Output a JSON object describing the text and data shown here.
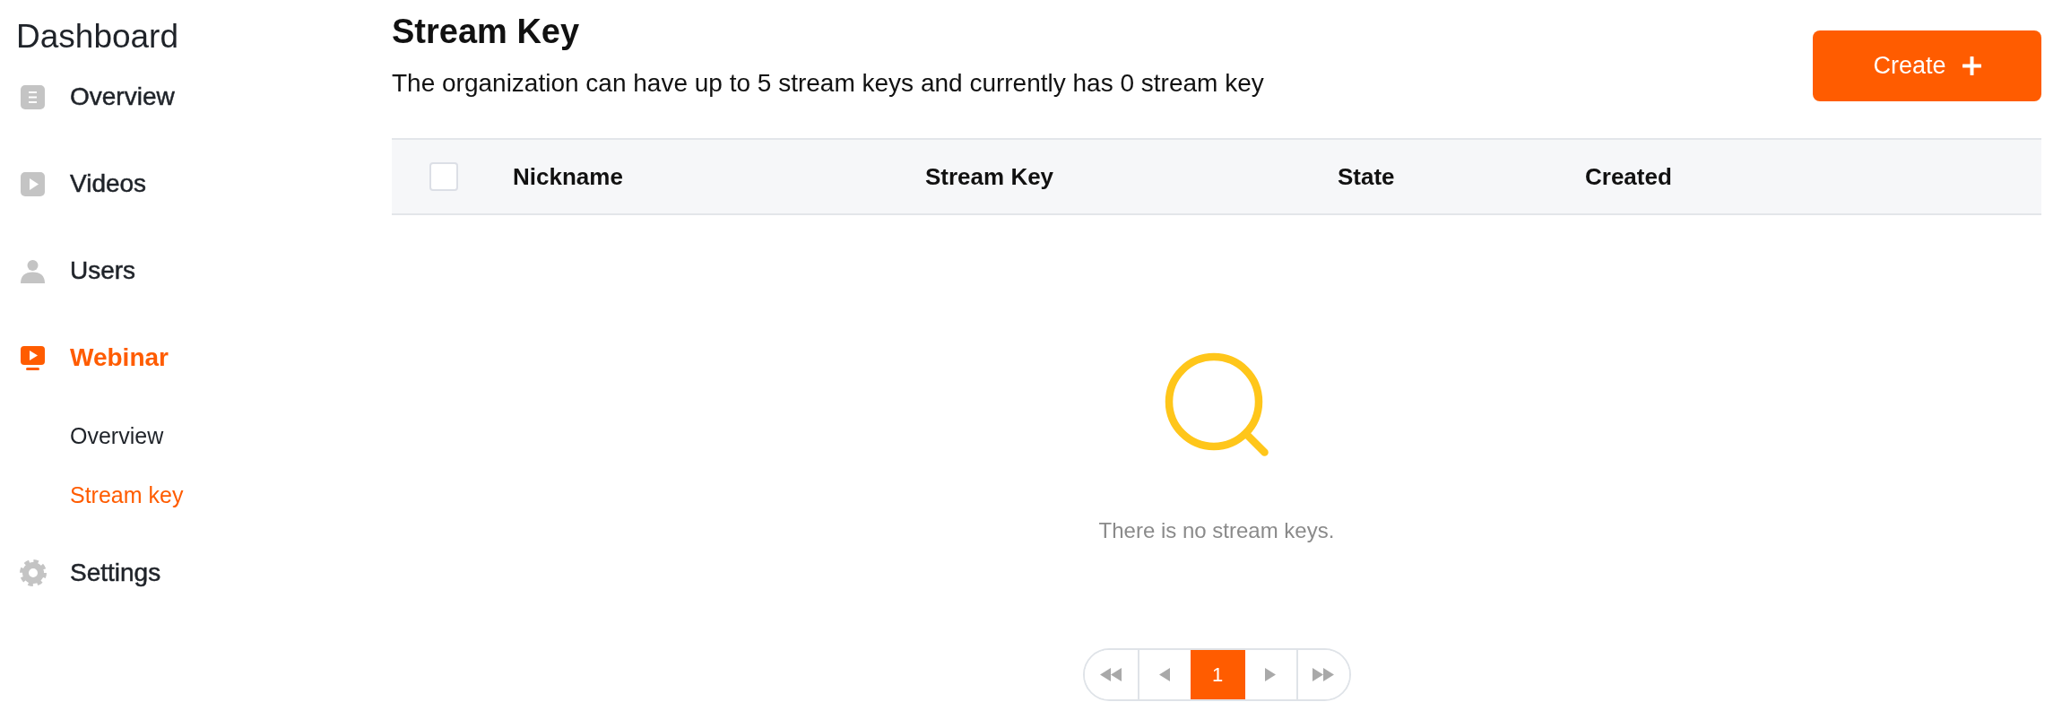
{
  "sidebar": {
    "title": "Dashboard",
    "items": [
      {
        "label": "Overview",
        "selected": false
      },
      {
        "label": "Videos",
        "selected": false
      },
      {
        "label": "Users",
        "selected": false
      },
      {
        "label": "Webinar",
        "selected": true,
        "children": [
          {
            "label": "Overview",
            "selected": false
          },
          {
            "label": "Stream key",
            "selected": true
          }
        ]
      },
      {
        "label": "Settings",
        "selected": false
      }
    ]
  },
  "header": {
    "title": "Stream Key",
    "description": "The organization can have up to 5 stream keys and currently has 0 stream key",
    "create_button": {
      "label": "Create"
    }
  },
  "table": {
    "select_all": {
      "checked": false
    },
    "columns": [
      "Nickname",
      "Stream Key",
      "State",
      "Created"
    ],
    "empty_message": "There is no stream keys."
  },
  "pagination": {
    "pages": [
      {
        "label": "1",
        "selected": true
      }
    ]
  }
}
